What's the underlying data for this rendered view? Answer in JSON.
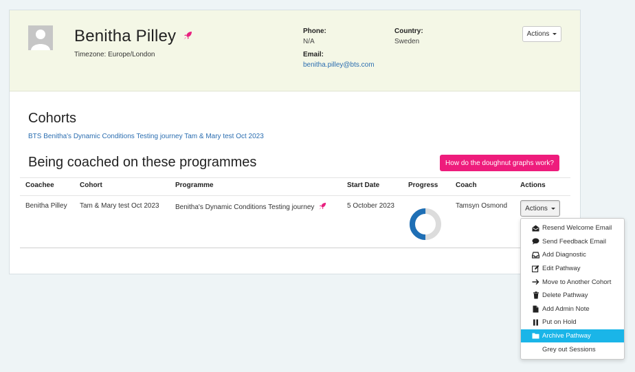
{
  "profile": {
    "name": "Benitha Pilley",
    "timezone": "Timezone: Europe/London",
    "phone_label": "Phone:",
    "phone_value": "N/A",
    "country_label": "Country:",
    "country_value": "Sweden",
    "email_label": "Email:",
    "email_value": "benitha.pilley@bts.com",
    "actions_label": "Actions"
  },
  "cohorts": {
    "title": "Cohorts",
    "link": "BTS Benitha's Dynamic Conditions Testing journey Tam & Mary test Oct 2023"
  },
  "programmes": {
    "title": "Being coached on these programmes",
    "help_button": "How do the doughnut graphs work?",
    "columns": [
      "Coachee",
      "Cohort",
      "Programme",
      "Start Date",
      "Progress",
      "Coach",
      "Actions"
    ],
    "rows": [
      {
        "coachee": "Benitha Pilley",
        "cohort": "Tam & Mary test Oct 2023",
        "programme": "Benitha's Dynamic Conditions Testing journey",
        "start_date": "5 October 2023",
        "progress_fraction": 0.5,
        "coach": "Tamsyn Osmond",
        "actions_label": "Actions"
      }
    ]
  },
  "dropdown": {
    "items": [
      {
        "label": "Resend Welcome Email",
        "icon": "envelope-open-icon"
      },
      {
        "label": "Send Feedback Email",
        "icon": "comment-icon"
      },
      {
        "label": "Add Diagnostic",
        "icon": "inbox-icon"
      },
      {
        "label": "Edit Pathway",
        "icon": "edit-icon"
      },
      {
        "label": "Move to Another Cohort",
        "icon": "arrow-right-icon"
      },
      {
        "label": "Delete Pathway",
        "icon": "trash-icon"
      },
      {
        "label": "Add Admin Note",
        "icon": "file-icon"
      },
      {
        "label": "Put on Hold",
        "icon": "pause-icon"
      },
      {
        "label": "Archive Pathway",
        "icon": "folder-icon",
        "active": true
      },
      {
        "label": "Grey out Sessions",
        "icon": ""
      }
    ]
  },
  "colors": {
    "header_bg": "#f4f7e6",
    "link": "#2a6db0",
    "pink_button": "#ee1c7c",
    "active_item": "#1ab5e8",
    "progress_done": "#1f6fb5",
    "progress_remaining": "#dcdcdc"
  }
}
